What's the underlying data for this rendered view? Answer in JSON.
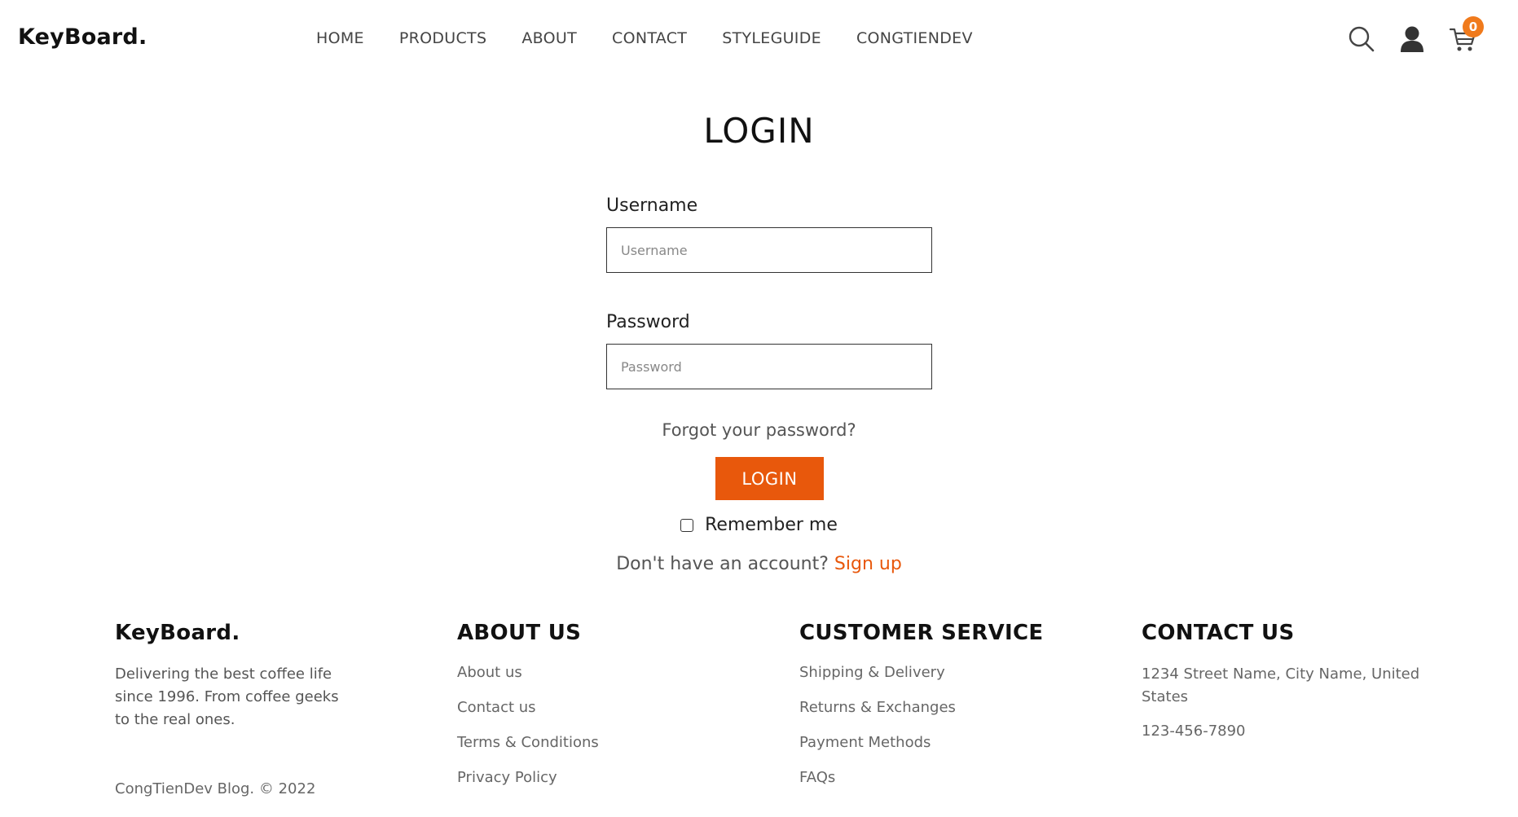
{
  "header": {
    "logo": "KeyBoard.",
    "nav": [
      "HOME",
      "PRODUCTS",
      "ABOUT",
      "CONTACT",
      "STYLEGUIDE",
      "CONGTIENDEV"
    ],
    "cart_count": "0",
    "icons": [
      "search-icon",
      "user-icon",
      "cart-icon"
    ]
  },
  "login": {
    "title": "LOGIN",
    "username_label": "Username",
    "username_placeholder": "Username",
    "password_label": "Password",
    "password_placeholder": "Password",
    "forgot": "Forgot your password?",
    "button": "LOGIN",
    "remember": "Remember me",
    "no_account": "Don't have an account?",
    "signup": "Sign up"
  },
  "footer": {
    "brand": "KeyBoard.",
    "description": "Delivering the best coffee life since 1996. From coffee geeks to the real ones.",
    "copyright": "CongTienDev Blog. © 2022",
    "about": {
      "heading": "ABOUT US",
      "links": [
        "About us",
        "Contact us",
        "Terms & Conditions",
        "Privacy Policy"
      ]
    },
    "service": {
      "heading": "CUSTOMER SERVICE",
      "links": [
        "Shipping & Delivery",
        "Returns & Exchanges",
        "Payment Methods",
        "FAQs"
      ]
    },
    "contact": {
      "heading": "CONTACT US",
      "address": "1234 Street Name, City Name, United States",
      "phone": "123-456-7890"
    }
  },
  "colors": {
    "accent": "#e8580c",
    "badge": "#f07a1c",
    "text": "#111111",
    "muted": "#666666"
  }
}
